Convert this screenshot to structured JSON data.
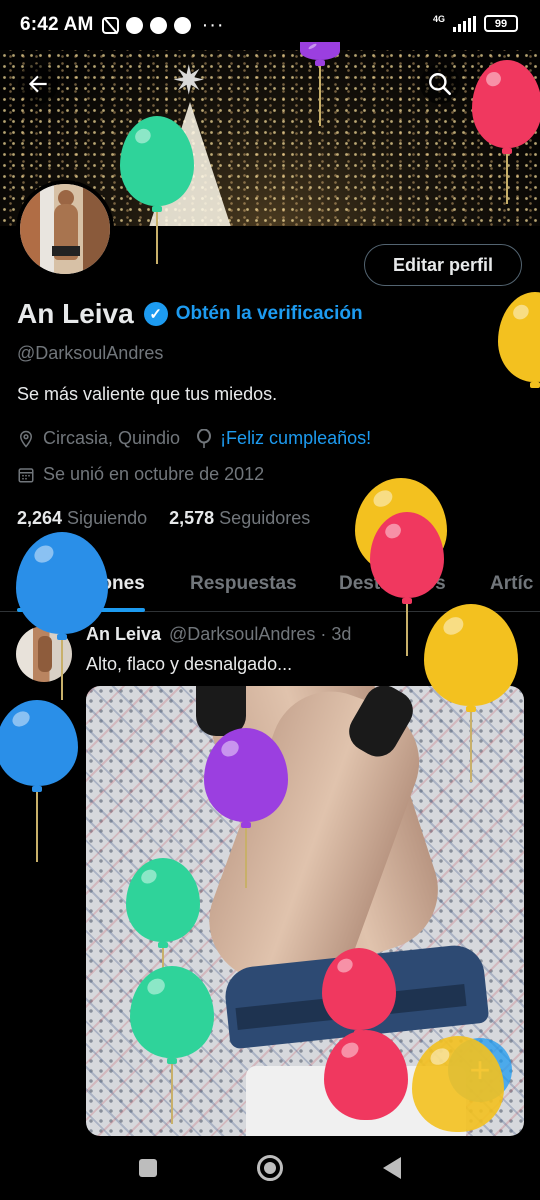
{
  "status_bar": {
    "time": "6:42 AM",
    "network": "4G",
    "battery": "99",
    "more": "···"
  },
  "profile": {
    "name": "An Leiva",
    "get_verified": "Obtén la verificación",
    "handle": "@DarksoulAndres",
    "bio": "Se más valiente que tus miedos.",
    "location": "Circasia, Quindio",
    "birthday_link": "¡Feliz cumpleaños!",
    "joined": "Se unió en octubre de 2012",
    "following_count": "2,264",
    "following_label": "Siguiendo",
    "followers_count": "2,578",
    "followers_label": "Seguidores",
    "edit_button": "Editar perfil"
  },
  "tabs": [
    {
      "label": "Publicaciones",
      "active": true
    },
    {
      "label": "Respuestas",
      "active": false
    },
    {
      "label": "Destacados",
      "active": false
    },
    {
      "label": "Artíc",
      "active": false
    }
  ],
  "post": {
    "author": "An Leiva",
    "handle_time": "@DarksoulAndres · 3d",
    "text": "Alto, flaco y desnalgado..."
  },
  "fab_label": "+",
  "icons": {
    "back": "arrow-left-icon",
    "search": "search-icon",
    "verified": "verified-badge-icon",
    "location": "location-pin-icon",
    "balloon": "balloon-icon",
    "calendar": "calendar-icon"
  },
  "colors": {
    "accent": "#1d9bf0",
    "background": "#000000",
    "text": "#e7e9ea",
    "muted": "#71767b",
    "balloon_green": "#2fd39a",
    "balloon_red": "#f0385f",
    "balloon_yellow": "#f3c11f",
    "balloon_purple": "#9b3fe0",
    "balloon_blue": "#2a8fe8"
  }
}
